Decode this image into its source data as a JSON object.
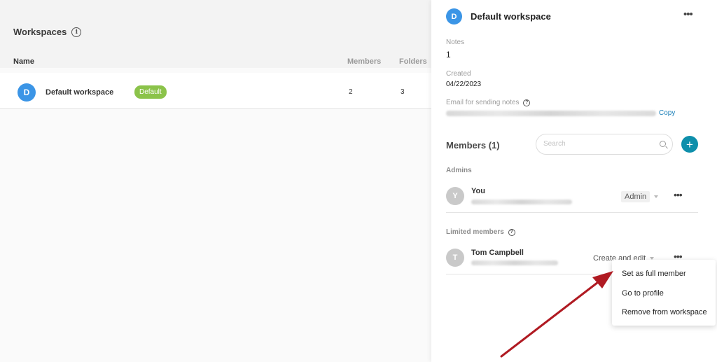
{
  "workspaces_page": {
    "title": "Workspaces",
    "columns": {
      "name": "Name",
      "members": "Members",
      "folders": "Folders"
    },
    "rows": [
      {
        "avatar_letter": "D",
        "name": "Default workspace",
        "badge": "Default",
        "members": "2",
        "folders": "3"
      }
    ]
  },
  "panel": {
    "avatar_letter": "D",
    "title": "Default workspace",
    "more_icon": "more-horizontal-icon",
    "notes_label": "Notes",
    "notes_value": "1",
    "created_label": "Created",
    "created_value": "04/22/2023",
    "email_label": "Email for sending notes",
    "copy_label": "Copy",
    "members_heading": "Members (1)",
    "search_placeholder": "Search",
    "add_symbol": "+",
    "admins_heading": "Admins",
    "admins": [
      {
        "avatar_letter": "Y",
        "name": "You",
        "role": "Admin"
      }
    ],
    "limited_heading": "Limited members",
    "limited": [
      {
        "avatar_letter": "T",
        "name": "Tom Campbell",
        "role": "Create and edit"
      }
    ]
  },
  "context_menu": {
    "items": [
      "Set as full member",
      "Go to profile",
      "Remove from workspace"
    ]
  },
  "colors": {
    "accent": "#0e8fab",
    "avatar_blue": "#3b95e6",
    "badge_green": "#8bc34a",
    "annotation_arrow": "#b01a22"
  }
}
